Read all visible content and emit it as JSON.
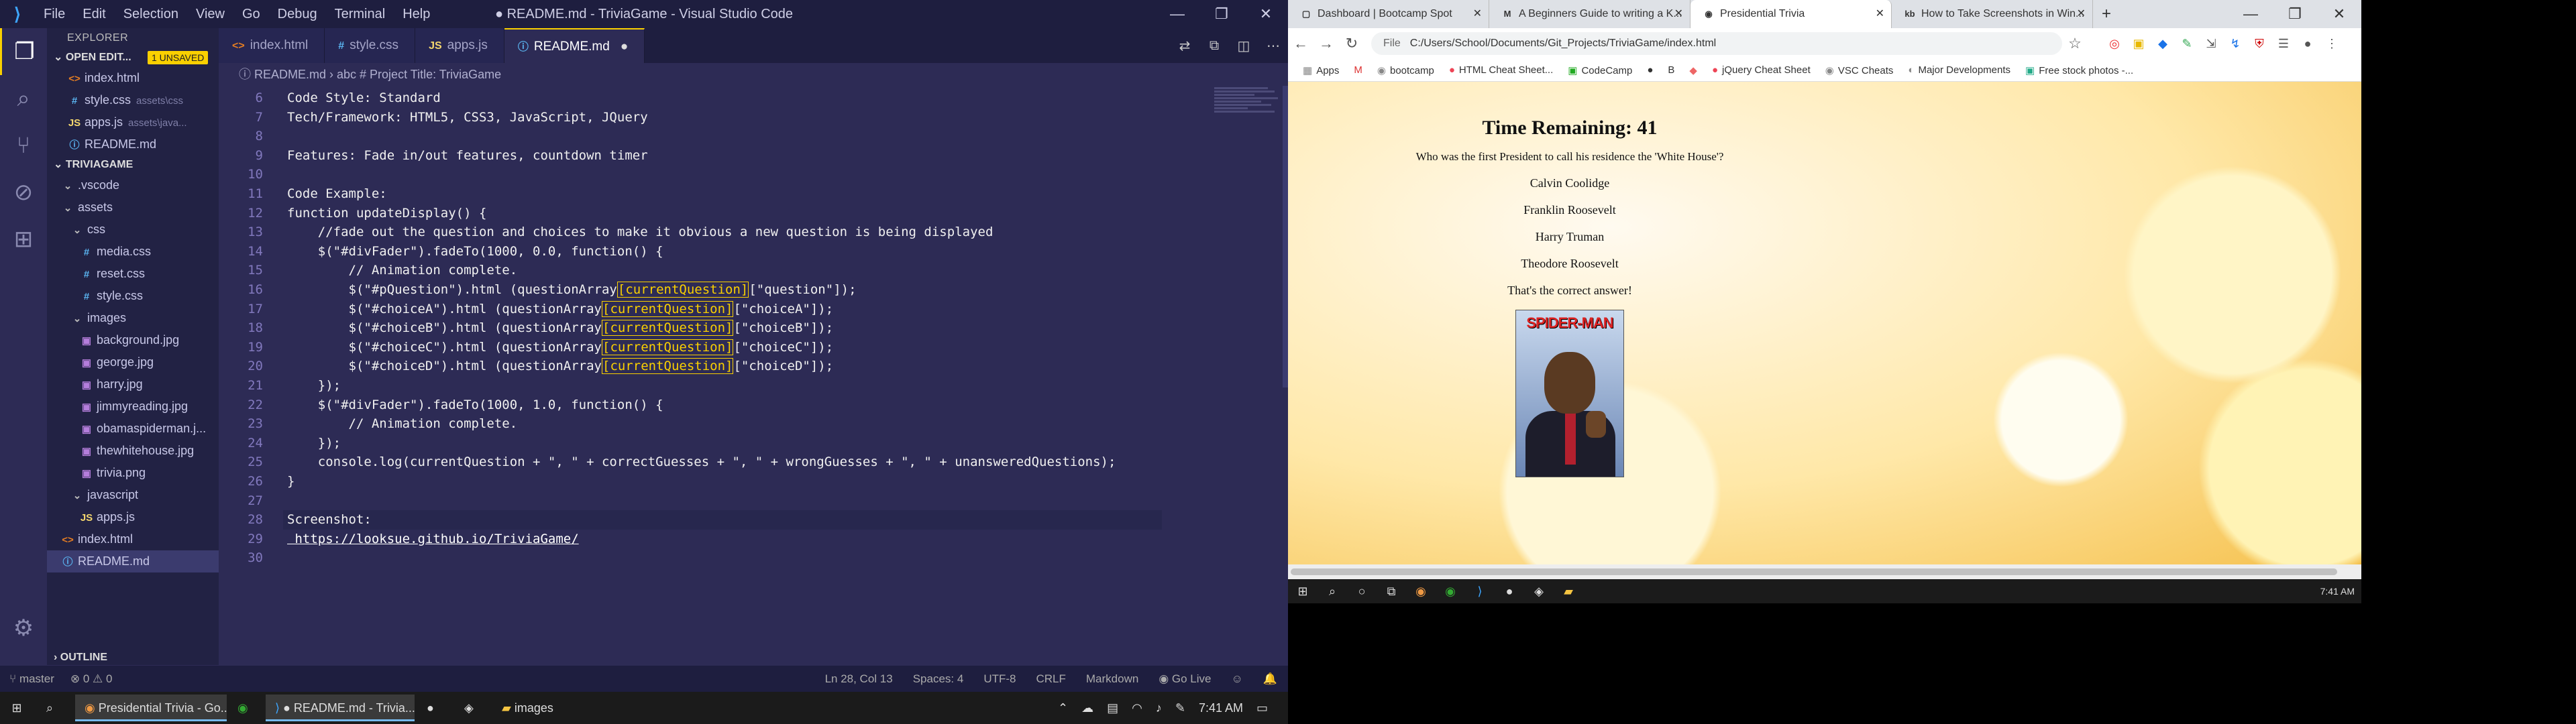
{
  "vscode": {
    "menu": [
      "File",
      "Edit",
      "Selection",
      "View",
      "Go",
      "Debug",
      "Terminal",
      "Help"
    ],
    "window_title": "● README.md - TriviaGame - Visual Studio Code",
    "explorer": {
      "header": "EXPLORER",
      "open_editors_label": "OPEN EDIT...",
      "unsaved_badge": "1 UNSAVED",
      "open_editors": [
        {
          "icon": "<>",
          "name": "index.html",
          "path": ""
        },
        {
          "icon": "#",
          "name": "style.css",
          "path": "assets\\css"
        },
        {
          "icon": "JS",
          "name": "apps.js",
          "path": "assets\\java..."
        },
        {
          "icon": "ⓘ",
          "name": "README.md",
          "path": ""
        }
      ],
      "project_label": "TRIVIAGAME",
      "tree": [
        {
          "name": ".vscode",
          "kind": "folder"
        },
        {
          "name": "assets",
          "kind": "folder"
        },
        {
          "name": "css",
          "kind": "folder"
        },
        {
          "name": "media.css",
          "kind": "css"
        },
        {
          "name": "reset.css",
          "kind": "css"
        },
        {
          "name": "style.css",
          "kind": "css"
        },
        {
          "name": "images",
          "kind": "folder"
        },
        {
          "name": "background.jpg",
          "kind": "img"
        },
        {
          "name": "george.jpg",
          "kind": "img"
        },
        {
          "name": "harry.jpg",
          "kind": "img"
        },
        {
          "name": "jimmyreading.jpg",
          "kind": "img"
        },
        {
          "name": "obamaspiderman.j...",
          "kind": "img"
        },
        {
          "name": "thewhitehouse.jpg",
          "kind": "img"
        },
        {
          "name": "trivia.png",
          "kind": "img"
        },
        {
          "name": "javascript",
          "kind": "folder"
        },
        {
          "name": "apps.js",
          "kind": "js"
        },
        {
          "name": "index.html",
          "kind": "html"
        },
        {
          "name": "README.md",
          "kind": "md"
        }
      ],
      "outline_label": "OUTLINE"
    },
    "tabs": [
      {
        "icon": "<>",
        "label": "index.html"
      },
      {
        "icon": "#",
        "label": "style.css"
      },
      {
        "icon": "JS",
        "label": "apps.js"
      },
      {
        "icon": "ⓘ",
        "label": "README.md"
      }
    ],
    "breadcrumb": "ⓘ README.md  ›  abc # Project Title: TriviaGame",
    "code": [
      {
        "n": "6",
        "t": "Code Style: Standard"
      },
      {
        "n": "7",
        "t": "Tech/Framework: HTML5, CSS3, JavaScript, JQuery"
      },
      {
        "n": "8",
        "t": ""
      },
      {
        "n": "9",
        "t": "Features: Fade in/out features, countdown timer"
      },
      {
        "n": "10",
        "t": ""
      },
      {
        "n": "11",
        "t": "Code Example:"
      },
      {
        "n": "12",
        "t": "function updateDisplay() {"
      },
      {
        "n": "13",
        "t": "    //fade out the question and choices to make it obvious a new question is being displayed"
      },
      {
        "n": "14",
        "t": "    $(\"#divFader\").fadeTo(1000, 0.0, function() {"
      },
      {
        "n": "15",
        "t": "        // Animation complete."
      },
      {
        "n": "16",
        "pre": "        $(\"#pQuestion\").html (questionArray",
        "hl": "[currentQuestion]",
        "post": "[\"question\"]);"
      },
      {
        "n": "17",
        "pre": "        $(\"#choiceA\").html (questionArray",
        "hl": "[currentQuestion]",
        "post": "[\"choiceA\"]);"
      },
      {
        "n": "18",
        "pre": "        $(\"#choiceB\").html (questionArray",
        "hl": "[currentQuestion]",
        "post": "[\"choiceB\"]);"
      },
      {
        "n": "19",
        "pre": "        $(\"#choiceC\").html (questionArray",
        "hl": "[currentQuestion]",
        "post": "[\"choiceC\"]);"
      },
      {
        "n": "20",
        "pre": "        $(\"#choiceD\").html (questionArray",
        "hl": "[currentQuestion]",
        "post": "[\"choiceD\"]);"
      },
      {
        "n": "21",
        "t": "    });"
      },
      {
        "n": "22",
        "t": "    $(\"#divFader\").fadeTo(1000, 1.0, function() {"
      },
      {
        "n": "23",
        "t": "        // Animation complete."
      },
      {
        "n": "24",
        "t": "    });"
      },
      {
        "n": "25",
        "t": "    console.log(currentQuestion + \", \" + correctGuesses + \", \" + wrongGuesses + \", \" + unansweredQuestions);"
      },
      {
        "n": "26",
        "t": "}"
      },
      {
        "n": "27",
        "t": ""
      },
      {
        "n": "28",
        "t": "Screenshot:"
      },
      {
        "n": "29",
        "t": " https://looksue.github.io/TriviaGame/",
        "link": true
      },
      {
        "n": "30",
        "t": ""
      }
    ],
    "status": {
      "branch": "master",
      "problems": "⊗ 0 ⚠ 0",
      "position": "Ln 28, Col 13",
      "spaces": "Spaces: 4",
      "encoding": "UTF-8",
      "eol": "CRLF",
      "language": "Markdown",
      "golive": "Go Live"
    }
  },
  "chrome": {
    "tabs": [
      {
        "fav": "▢",
        "title": "Dashboard | Bootcamp Spot"
      },
      {
        "fav": "M",
        "title": "A Beginners Guide to writing a K..."
      },
      {
        "fav": "◉",
        "title": "Presidential Trivia"
      },
      {
        "fav": "kb",
        "title": "How to Take Screenshots in Win..."
      }
    ],
    "omnibox": {
      "label": "File",
      "url": "C:/Users/School/Documents/Git_Projects/TriviaGame/index.html"
    },
    "bookmarks": [
      "Apps",
      "",
      "bootcamp",
      "HTML Cheat Sheet...",
      "CodeCamp",
      "",
      "",
      "",
      "jQuery Cheat Sheet",
      "VSC Cheats",
      "Major Developments",
      "Free stock photos -..."
    ],
    "page": {
      "title": "Time Remaining: 41",
      "question": "Who was the first President to call his residence the 'White House'?",
      "choices": [
        "Calvin Coolidge",
        "Franklin Roosevelt",
        "Harry Truman",
        "Theodore Roosevelt"
      ],
      "result": "That's the correct answer!",
      "image_caption": "SPIDER-MAN"
    },
    "taskbar_clock": "7:41 AM"
  },
  "taskbar": {
    "apps": [
      {
        "label": "Presidential Trivia - Go...",
        "active": true
      },
      {
        "label": "",
        "active": false
      },
      {
        "label": "● README.md - Trivia...",
        "active": true
      },
      {
        "label": "",
        "active": false
      },
      {
        "label": "",
        "active": false
      },
      {
        "label": "images",
        "active": false
      }
    ],
    "clock": "7:41 AM"
  }
}
